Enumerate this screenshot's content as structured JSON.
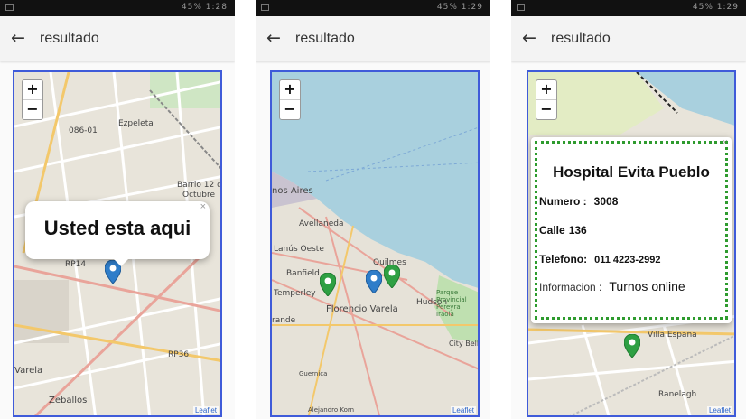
{
  "status_bar": {
    "phone1_time": "1:28",
    "phone2_time": "1:29",
    "phone3_time": "1:29",
    "battery": "45%"
  },
  "appbar": {
    "back_glyph": "←",
    "title": "resultado"
  },
  "map": {
    "zoom_in": "+",
    "zoom_out": "−",
    "attribution": "Leaflet"
  },
  "screen1": {
    "popup_text": "Usted esta aqui",
    "close": "×",
    "labels": {
      "epeleta": "Ezpeleta",
      "barrio": "Barrio 12 de",
      "barrio2": "Octubre",
      "varela": "Varela",
      "zeballos": "Zeballos",
      "road1": "086-01",
      "road2": "RP14",
      "road3": "RP36"
    }
  },
  "screen2": {
    "labels": {
      "aires": "nos Aires",
      "avellaneda": "Avellaneda",
      "lanus": "Lanús Oeste",
      "quilmes": "Quilmes",
      "banfield": "Banfield",
      "temperley": "Temperley",
      "florencio": "Florencio Varela",
      "brande": "rande",
      "hudson": "Hudson",
      "citybell": "City Bell",
      "parque": "Parque Provincial Pereyra Iraola",
      "alejandro": "Alejandro Korn",
      "guernica": "Guernica"
    }
  },
  "screen3": {
    "hospital_name": "Hospital Evita Pueblo",
    "numero_label": "Numero :",
    "numero_value": "3008",
    "calle_label": "Calle",
    "calle_value": "136",
    "telefono_label": "Telefono:",
    "telefono_value": "011 4223-2992",
    "info_label": "Informacion :",
    "info_value": "Turnos online",
    "close": "×",
    "labels": {
      "villa": "Villa España",
      "ranelagh": "Ranelagh"
    }
  },
  "colors": {
    "map_border": "#3f5bd9",
    "marker_blue": "#2f7dc9",
    "marker_green": "#2ea043",
    "water": "#a9d0de",
    "popup_dotted_border": "#2e9b2e"
  },
  "icons": {
    "back": "arrow-left-icon",
    "marker": "map-marker-icon"
  }
}
